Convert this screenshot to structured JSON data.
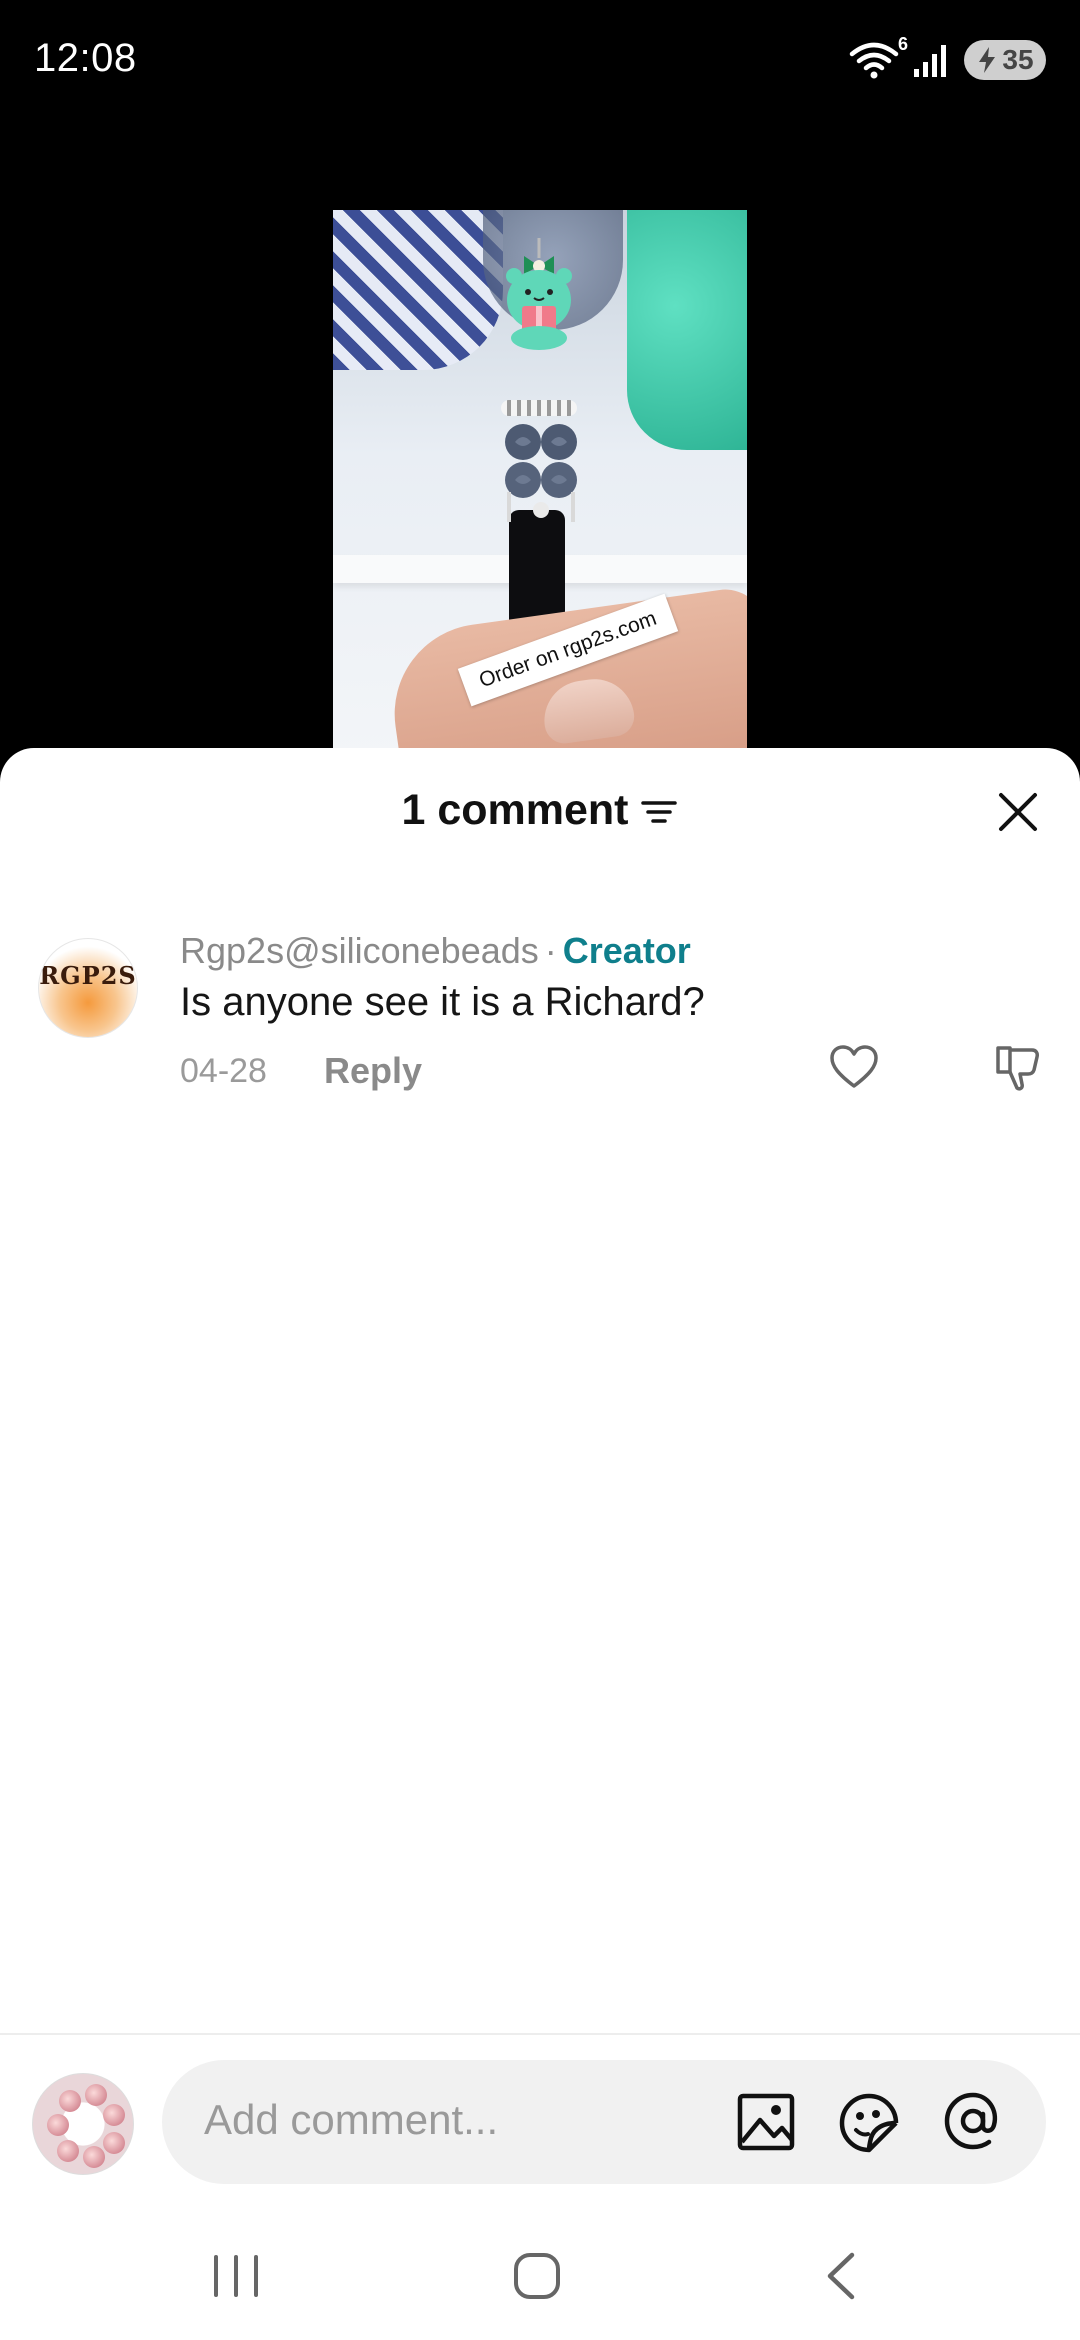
{
  "status_bar": {
    "time": "12:08",
    "wifi_badge": "6",
    "battery_level": "35"
  },
  "video": {
    "overlay_text": "Order on rgp2s.com"
  },
  "sheet": {
    "title": "1 comment",
    "comments": [
      {
        "avatar_label": "RGP2S",
        "author": "Rgp2s@siliconebeads",
        "separator": "·",
        "badge": "Creator",
        "text": "Is anyone see it is a Richard?",
        "date": "04-28",
        "reply_label": "Reply"
      }
    ]
  },
  "input_bar": {
    "placeholder": "Add comment..."
  },
  "icons": {
    "filter": "filter-icon",
    "close": "close-icon",
    "like": "heart-icon",
    "dislike": "thumbs-down-icon",
    "image": "image-icon",
    "sticker": "sticker-icon",
    "mention": "at-icon",
    "nav_recent": "recent-apps-icon",
    "nav_home": "home-icon",
    "nav_back": "back-icon"
  },
  "colors": {
    "creator_accent": "#0f7f8c",
    "muted_text": "#8a8a8a"
  }
}
